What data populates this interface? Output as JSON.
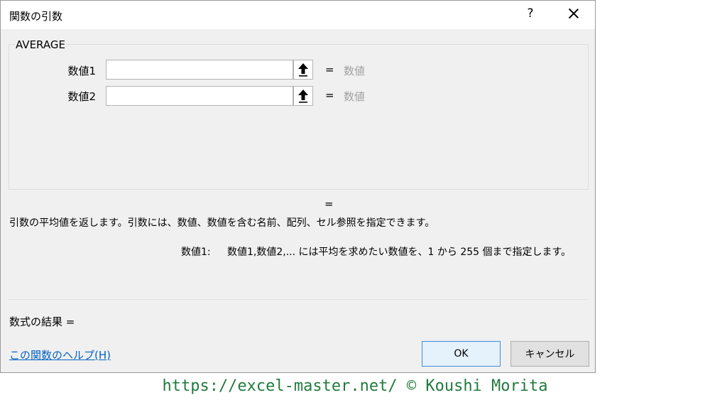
{
  "dialog": {
    "title": "関数の引数",
    "help_glyph": "?",
    "function_name": "AVERAGE",
    "args": [
      {
        "label": "数値1",
        "value": "",
        "equals": "=",
        "result": "数値"
      },
      {
        "label": "数値2",
        "value": "",
        "equals": "=",
        "result": "数値"
      }
    ],
    "formula_equals": "=",
    "description": "引数の平均値を返します。引数には、数値、数値を含む名前、配列、セル参照を指定できます。",
    "arg_help_label": "数値1:",
    "arg_help_text": "数値1,数値2,... には平均を求めたい数値を、1 から 255 個まで指定します。",
    "formula_result_label": "数式の結果 =",
    "help_link": "この関数のヘルプ(H)",
    "ok_label": "OK",
    "cancel_label": "キャンセル"
  },
  "watermark": "https://excel-master.net/  © Koushi Morita",
  "colors": {
    "accent": "#3c8fdc",
    "link": "#0563c1",
    "watermark": "#217a3e"
  }
}
